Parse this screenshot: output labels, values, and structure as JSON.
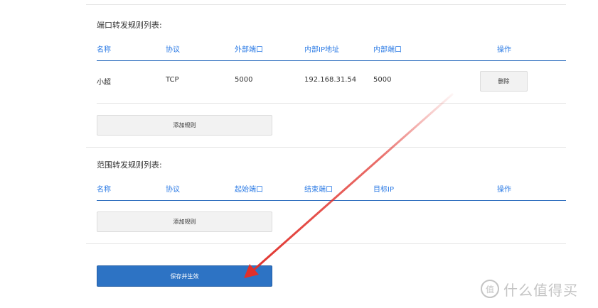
{
  "port_forward": {
    "title": "端口转发规则列表:",
    "headers": [
      "名称",
      "协议",
      "外部端口",
      "内部IP地址",
      "内部端口",
      "操作"
    ],
    "rows": [
      {
        "name": "小超",
        "protocol": "TCP",
        "external_port": "5000",
        "internal_ip": "192.168.31.54",
        "internal_port": "5000",
        "delete_label": "删除"
      }
    ],
    "add_label": "添加规则"
  },
  "range_forward": {
    "title": "范围转发规则列表:",
    "headers": [
      "名称",
      "协议",
      "起始端口",
      "结束端口",
      "目标IP",
      "操作"
    ],
    "add_label": "添加规则"
  },
  "save_label": "保存并生效",
  "watermark": {
    "logo_char": "值",
    "text": "什么值得买"
  },
  "colors": {
    "header_text": "#2c7be5",
    "header_rule": "#2f6fbf",
    "save_button": "#2d73c4",
    "arrow": "#e0302a"
  }
}
